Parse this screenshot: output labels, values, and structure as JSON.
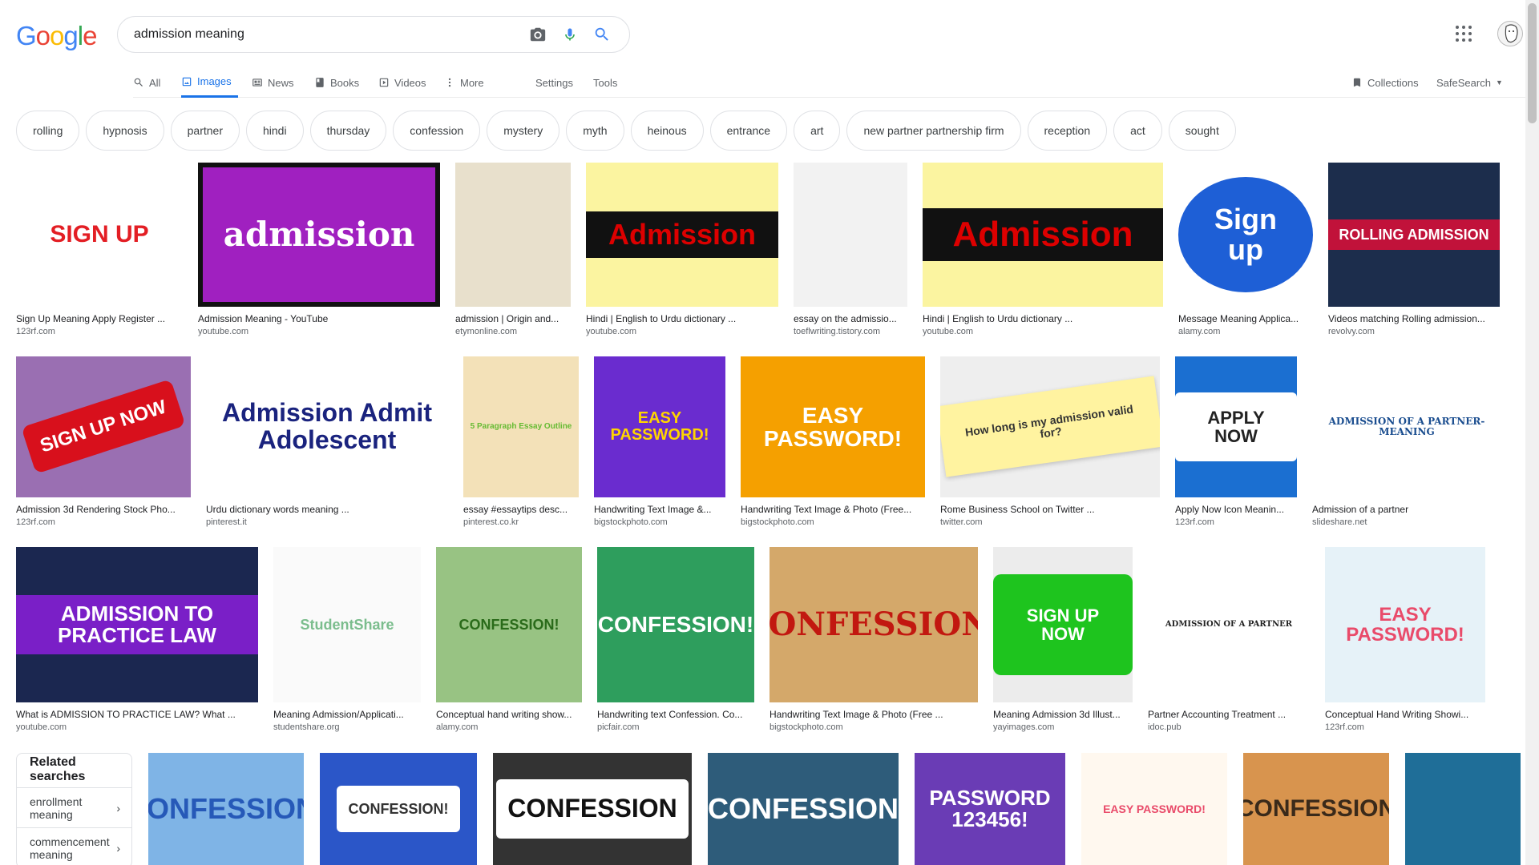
{
  "logo": "Google",
  "search": {
    "value": "admission meaning"
  },
  "tabs": [
    {
      "label": "All",
      "icon": "search-icon"
    },
    {
      "label": "Images",
      "icon": "image-icon"
    },
    {
      "label": "News",
      "icon": "news-icon"
    },
    {
      "label": "Books",
      "icon": "book-icon"
    },
    {
      "label": "Videos",
      "icon": "video-icon"
    },
    {
      "label": "More",
      "icon": "more-vert-icon"
    },
    {
      "label": "Settings"
    },
    {
      "label": "Tools"
    },
    {
      "label": "Collections",
      "icon": "bookmark-icon"
    },
    {
      "label": "SafeSearch"
    }
  ],
  "chips": [
    "rolling",
    "hypnosis",
    "partner",
    "hindi",
    "thursday",
    "confession",
    "mystery",
    "myth",
    "heinous",
    "entrance",
    "art",
    "new partner partnership firm",
    "reception",
    "act",
    "sought"
  ],
  "rows": [
    [
      {
        "caption": "Sign Up Meaning Apply Register ...",
        "source": "123rf.com",
        "thumb": "SIGN UP"
      },
      {
        "caption": "Admission Meaning - YouTube",
        "source": "youtube.com",
        "thumb": "admission"
      },
      {
        "caption": "admission | Origin and...",
        "source": "etymonline.com",
        "thumb": ""
      },
      {
        "caption": "Hindi | English to Urdu dictionary ...",
        "source": "youtube.com",
        "thumb": "Admission"
      },
      {
        "caption": "essay on the admissio...",
        "source": "toeflwriting.tistory.com",
        "thumb": ""
      },
      {
        "caption": "Hindi | English to Urdu dictionary ...",
        "source": "youtube.com",
        "thumb": "Admission"
      },
      {
        "caption": "Message Meaning Applica...",
        "source": "alamy.com",
        "thumb": "Sign up"
      },
      {
        "caption": "Videos matching Rolling admission...",
        "source": "revolvy.com",
        "thumb": "ROLLING ADMISSION"
      }
    ],
    [
      {
        "caption": "Admission 3d Rendering Stock Pho...",
        "source": "123rf.com",
        "thumb": "SIGN UP NOW"
      },
      {
        "caption": "Urdu dictionary words meaning ...",
        "source": "pinterest.it",
        "thumb": "Admission Admit Adolescent"
      },
      {
        "caption": "essay #essaytips desc...",
        "source": "pinterest.co.kr",
        "thumb": "5 Paragraph Essay Outline"
      },
      {
        "caption": "Handwriting Text Image &...",
        "source": "bigstockphoto.com",
        "thumb": "EASY PASSWORD!"
      },
      {
        "caption": "Handwriting Text Image & Photo (Free...",
        "source": "bigstockphoto.com",
        "thumb": "EASY PASSWORD!"
      },
      {
        "caption": "Rome Business School on Twitter ...",
        "source": "twitter.com",
        "thumb": "How long is my admission valid for?"
      },
      {
        "caption": "Apply Now Icon Meanin...",
        "source": "123rf.com",
        "thumb": "APPLY NOW"
      },
      {
        "caption": "Admission of a partner",
        "source": "slideshare.net",
        "thumb": "ADMISSION OF A PARTNER-MEANING"
      }
    ],
    [
      {
        "caption": "What is ADMISSION TO PRACTICE LAW? What ...",
        "source": "youtube.com",
        "thumb": "ADMISSION TO PRACTICE LAW"
      },
      {
        "caption": "Meaning Admission/Applicati...",
        "source": "studentshare.org",
        "thumb": "StudentShare"
      },
      {
        "caption": "Conceptual hand writing show...",
        "source": "alamy.com",
        "thumb": "CONFESSION!"
      },
      {
        "caption": "Handwriting text Confession. Co...",
        "source": "picfair.com",
        "thumb": "CONFESSION!"
      },
      {
        "caption": "Handwriting Text Image & Photo (Free ...",
        "source": "bigstockphoto.com",
        "thumb": "CONFESSION!"
      },
      {
        "caption": "Meaning Admission 3d Illust...",
        "source": "yayimages.com",
        "thumb": "SIGN UP NOW"
      },
      {
        "caption": "Partner Accounting Treatment ...",
        "source": "idoc.pub",
        "thumb": "ADMISSION OF A PARTNER"
      },
      {
        "caption": "Conceptual Hand Writing Showi...",
        "source": "123rf.com",
        "thumb": "EASY PASSWORD!"
      }
    ],
    [
      {
        "thumb": "CONFESSION!"
      },
      {
        "thumb": "CONFESSION!"
      },
      {
        "thumb": "CONFESSION"
      },
      {
        "thumb": "CONFESSION"
      },
      {
        "thumb": "PASSWORD 123456!"
      },
      {
        "thumb": "EASY PASSWORD!"
      },
      {
        "thumb": "CONFESSION"
      },
      {
        "thumb": ""
      }
    ]
  ],
  "related": {
    "title": "Related searches",
    "items": [
      "enrollment meaning",
      "commencement meaning"
    ]
  },
  "colors": {
    "accent": "#1a73e8",
    "logo": [
      "#4285f4",
      "#ea4335",
      "#fbbc05",
      "#4285f4",
      "#34a853",
      "#ea4335"
    ]
  }
}
